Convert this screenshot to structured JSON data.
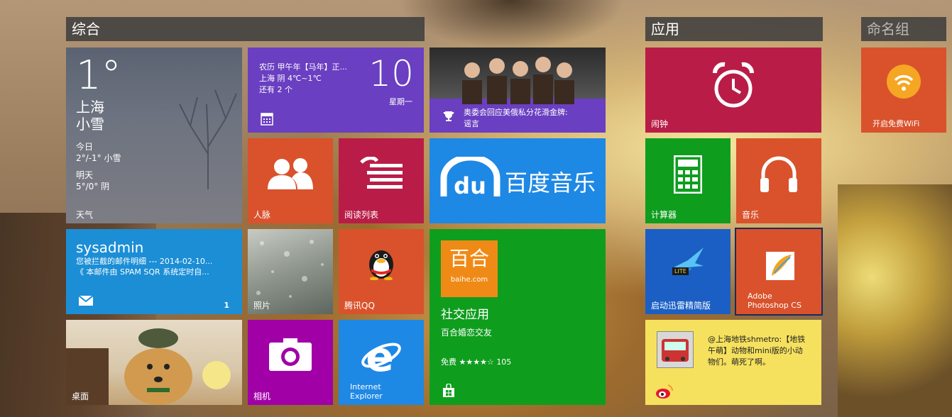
{
  "groups": {
    "general": "综合",
    "apps": "应用",
    "named": "命名组"
  },
  "weather": {
    "temp": "1°",
    "city": "上海",
    "condition": "小雪",
    "today_label": "今日",
    "today_value": "2°/-1° 小雪",
    "tomorrow_label": "明天",
    "tomorrow_value": "5°/0° 阴",
    "tile_label": "天气"
  },
  "calendar": {
    "line1": "农历 甲午年【马年】正...",
    "line2": "上海 阴 4℃~1℃",
    "line3": "还有 2 个",
    "day": "10",
    "weekday": "星期一"
  },
  "news": {
    "headline_line1": "奥委会回应美俄私分花滑金牌:",
    "headline_line2": "谣言"
  },
  "people": {
    "label": "人脉"
  },
  "reading": {
    "label": "阅读列表"
  },
  "music_brand": {
    "du": "du",
    "name": "百度音乐"
  },
  "mail": {
    "account": "sysadmin",
    "subject": "您被拦截的邮件明细 --- 2014-02-10...",
    "preview": "《 本邮件由 SPAM SQR 系统定时自...",
    "count": "1"
  },
  "photos": {
    "label": "照片"
  },
  "qq": {
    "label": "腾讯QQ"
  },
  "social": {
    "logo_text": "百合",
    "logo_sub": "baihe.com",
    "title": "社交应用",
    "subtitle": "百合婚恋交友",
    "price": "免费",
    "stars": "★★★★☆",
    "reviews": "105"
  },
  "desktop": {
    "label": "桌面"
  },
  "camera": {
    "label": "相机"
  },
  "ie": {
    "label_line1": "Internet",
    "label_line2": "Explorer"
  },
  "alarm": {
    "label": "闹钟"
  },
  "calculator": {
    "label": "计算器"
  },
  "music": {
    "label": "音乐"
  },
  "xunlei": {
    "label": "启动迅雷精简版",
    "badge": "LITE"
  },
  "photoshop": {
    "label_line1": "Adobe",
    "label_line2": "Photoshop CS"
  },
  "weibo": {
    "text_line1": "@上海地铁shmetro:【地铁",
    "text_line2": "午萌】动物和mini版的小动",
    "text_line3": "物们。萌死了啊。"
  },
  "wifi": {
    "label": "开启免费WiFi"
  },
  "colors": {
    "purple": "#6a3fc1",
    "orange": "#d9522c",
    "crimson": "#b91d47",
    "blue": "#1e88e5",
    "mail_blue": "#1b8ed6",
    "green": "#0f9d1e",
    "magenta": "#a100a7",
    "yellow": "#f6e15e",
    "weibo_red": "#e6162d"
  }
}
